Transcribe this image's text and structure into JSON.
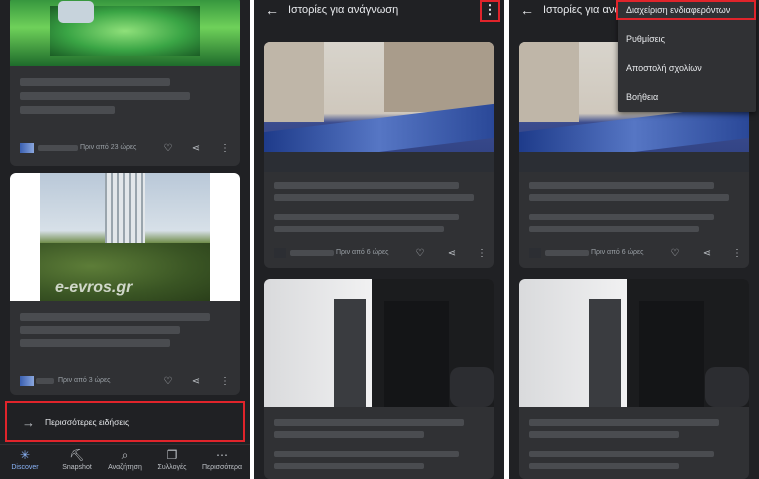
{
  "panel1": {
    "card1_time": "Πριν από 23 ώρες",
    "card2_time": "Πριν από 3 ώρες",
    "card2_watermark": "e-evros.gr",
    "more_news": "Περισσότερες ειδήσεις",
    "nav": [
      {
        "label": "Discover",
        "icon": "asterisk-icon"
      },
      {
        "label": "Snapshot",
        "icon": "snapshot-icon"
      },
      {
        "label": "Αναζήτηση",
        "icon": "search-icon"
      },
      {
        "label": "Συλλογές",
        "icon": "collections-icon"
      },
      {
        "label": "Περισσότερα",
        "icon": "more-icon"
      }
    ]
  },
  "panel2": {
    "title": "Ιστορίες για ανάγνωση",
    "card1_time": "Πριν από 6 ώρες"
  },
  "panel3": {
    "title": "Ιστορίες για ανάγ",
    "card1_time": "Πριν από 6 ώρες",
    "menu": [
      "Διαχείριση ενδιαφερόντων",
      "Ρυθμίσεις",
      "Αποστολή σχολίων",
      "Βοήθεια"
    ]
  },
  "colors": {
    "background": "#202124",
    "card": "#303134",
    "highlight": "#e0242b",
    "accent": "#8ab4f8"
  }
}
